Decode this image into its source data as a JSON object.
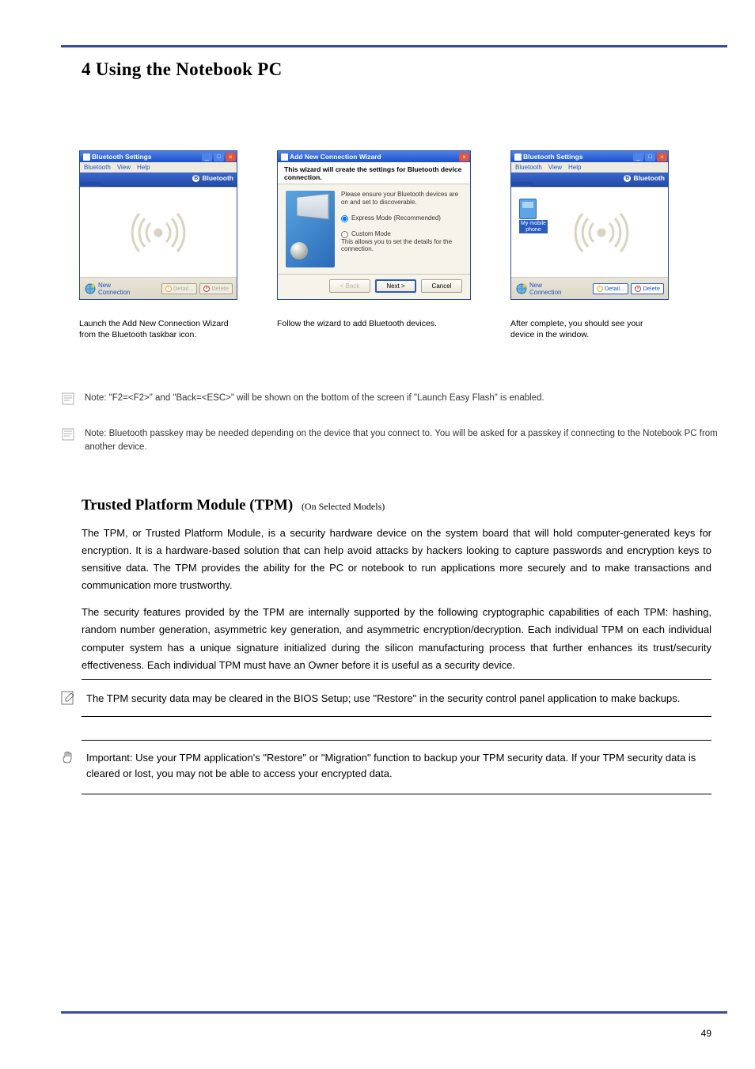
{
  "section_heading": "4    Using the Notebook PC",
  "shot1": {
    "title": "Bluetooth Settings",
    "menu": [
      "Bluetooth",
      "View",
      "Help"
    ],
    "brand": "Bluetooth",
    "new_connection": "New\nConnection",
    "btn_detail": "Detail...",
    "btn_delete": "Delete"
  },
  "shot2": {
    "title": "Add New Connection Wizard",
    "headline": "This wizard will create the settings for Bluetooth device connection.",
    "hint": "Please ensure your Bluetooth devices are on and set to discoverable.",
    "opt_express": "Express Mode (Recommended)",
    "opt_custom": "Custom Mode",
    "opt_custom_sub": "This allows you to set the details for the connection.",
    "btn_back": "< Back",
    "btn_next": "Next >",
    "btn_cancel": "Cancel"
  },
  "shot3": {
    "device_label": "My mobile\nphone",
    "title": "Bluetooth Settings",
    "menu": [
      "Bluetooth",
      "View",
      "Help"
    ],
    "brand": "Bluetooth",
    "new_connection": "New\nConnection",
    "btn_detail": "Detail...",
    "btn_delete": "Delete"
  },
  "cap1": "Launch the Add New Connection Wizard from the Bluetooth taskbar icon.",
  "cap2": "Follow the wizard to add Bluetooth devices.",
  "cap3": "After complete, you should see your device in the window.",
  "note1": "Note: \"F2=<F2>\" and \"Back=<ESC>\" will be shown on the bottom of the screen if \"Launch Easy Flash\" is enabled.",
  "note2": "Note: Bluetooth passkey may be needed depending on the device that you connect to. You will be asked for a passkey if connecting to the Notebook PC from another device.",
  "tpm_title": "Trusted Platform Module (TPM)",
  "tpm_p1": "The TPM, or Trusted Platform Module, is a security hardware device on the system board that will hold computer-generated keys for encryption. It is a hardware-based solution that can help avoid attacks by hackers looking to capture passwords and encryption keys to sensitive data. The TPM provides the ability for the PC or notebook to run applications more securely and to make transactions and communication more trustworthy.",
  "tpm_p2": "The security features provided by the TPM are internally supported by the following cryptographic capabilities of each TPM: hashing, random number generation, asymmetric key generation, and asymmetric encryption/decryption. Each individual TPM on each individual computer system has a unique signature initialized during the silicon manufacturing process that further enhances its trust/security effectiveness. Each individual TPM must have an Owner before it is useful as a security device.",
  "models_label": "(On Selected Models)",
  "tip1": "The tip text: The TPM security data may be cleared in the BIOS Setup; use \"Restore\" in the security control panel application to make backups.",
  "tip1_actual": "The TPM security data may be cleared in the BIOS Setup; use \"Restore\" in the security control panel application to make backups.",
  "tip2": "Important: Use your TPM application's \"Restore\" or \"Migration\" function to backup your TPM security data. If your TPM security data is cleared or lost, you may not be able to access your encrypted data.",
  "page_number": "49"
}
